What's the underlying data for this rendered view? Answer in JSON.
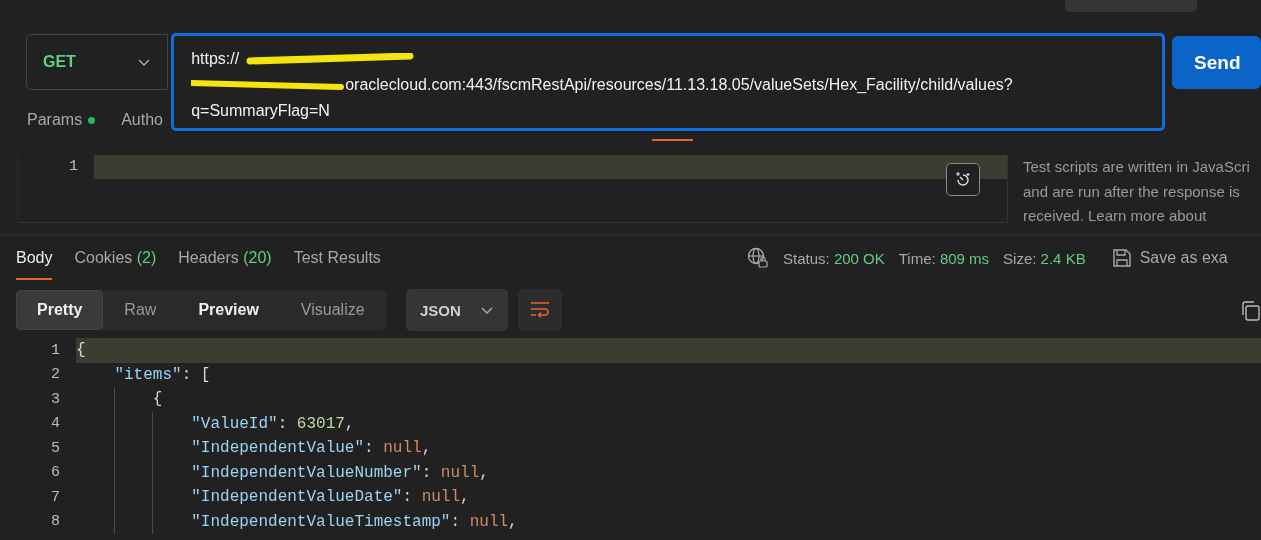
{
  "request": {
    "method": "GET",
    "url_lines": [
      "https://",
      "oraclecloud.com:443/fscmRestApi/resources/11.13.18.05/valueSets/Hex_Facility/child/values?",
      "q=SummaryFlag=N"
    ],
    "send": "Send"
  },
  "request_tabs": [
    {
      "label": "Params",
      "dot": true
    },
    {
      "label": "Autho",
      "dot": false
    }
  ],
  "script_editor": {
    "line_numbers": [
      "1"
    ]
  },
  "help_text": [
    "Test scripts are written in JavaScri",
    "and are run after the response is",
    "received. Learn more about"
  ],
  "response_tabs": [
    {
      "label": "Body",
      "selected": true
    },
    {
      "label": "Cookies",
      "count": "(2)",
      "selected": false
    },
    {
      "label": "Headers",
      "count": "(20)",
      "selected": false
    },
    {
      "label": "Test Results",
      "selected": false
    }
  ],
  "response_meta": [
    {
      "label": "Status:",
      "value": "200 OK"
    },
    {
      "label": "Time:",
      "value": "809 ms"
    },
    {
      "label": "Size:",
      "value": "2.4 KB"
    }
  ],
  "save_example": "Save as exa",
  "view_modes": [
    {
      "label": "Pretty",
      "selected": true,
      "bold": true
    },
    {
      "label": "Raw",
      "selected": false,
      "bold": false
    },
    {
      "label": "Preview",
      "selected": false,
      "bold": true
    },
    {
      "label": "Visualize",
      "selected": false,
      "bold": false
    }
  ],
  "format": "JSON",
  "code_lines": [
    {
      "number": "1",
      "tokens": [
        {
          "kind": "punct",
          "text": "{"
        }
      ]
    },
    {
      "number": "2",
      "tokens": [
        {
          "kind": "key",
          "text": "    \"items\""
        },
        {
          "kind": "punct",
          "text": ": ["
        }
      ]
    },
    {
      "number": "3",
      "tokens": [
        {
          "kind": "punct",
          "text": "        {"
        }
      ]
    },
    {
      "number": "4",
      "tokens": [
        {
          "kind": "key",
          "text": "            \"ValueId\""
        },
        {
          "kind": "punct",
          "text": ": "
        },
        {
          "kind": "number",
          "text": "63017"
        },
        {
          "kind": "punct",
          "text": ","
        }
      ]
    },
    {
      "number": "5",
      "tokens": [
        {
          "kind": "key",
          "text": "            \"IndependentValue\""
        },
        {
          "kind": "punct",
          "text": ": "
        },
        {
          "kind": "null",
          "text": "null"
        },
        {
          "kind": "punct",
          "text": ","
        }
      ]
    },
    {
      "number": "6",
      "tokens": [
        {
          "kind": "key",
          "text": "            \"IndependentValueNumber\""
        },
        {
          "kind": "punct",
          "text": ": "
        },
        {
          "kind": "null",
          "text": "null"
        },
        {
          "kind": "punct",
          "text": ","
        }
      ]
    },
    {
      "number": "7",
      "tokens": [
        {
          "kind": "key",
          "text": "            \"IndependentValueDate\""
        },
        {
          "kind": "punct",
          "text": ": "
        },
        {
          "kind": "null",
          "text": "null"
        },
        {
          "kind": "punct",
          "text": ","
        }
      ]
    },
    {
      "number": "8",
      "tokens": [
        {
          "kind": "key",
          "text": "            \"IndependentValueTimestamp\""
        },
        {
          "kind": "punct",
          "text": ": "
        },
        {
          "kind": "null",
          "text": "null"
        },
        {
          "kind": "punct",
          "text": ","
        }
      ]
    }
  ]
}
